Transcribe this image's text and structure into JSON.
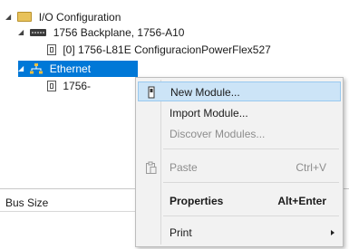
{
  "tree": {
    "root": {
      "label": "I/O Configuration",
      "icon": "folder-icon"
    },
    "backplane": {
      "label": "1756 Backplane, 1756-A10",
      "icon": "backplane-icon"
    },
    "controller": {
      "label": "[0] 1756-L81E ConfiguracionPowerFlex527",
      "icon": "module-icon"
    },
    "ethernet": {
      "label": "Ethernet",
      "icon": "network-icon"
    },
    "child": {
      "label": "1756-",
      "icon": "module-icon"
    }
  },
  "bottom_panel": {
    "bus_size_label": "Bus Size"
  },
  "context_menu": {
    "new_module": "New Module...",
    "import_module": "Import Module...",
    "discover_modules": "Discover Modules...",
    "paste": "Paste",
    "paste_shortcut": "Ctrl+V",
    "properties": "Properties",
    "properties_shortcut": "Alt+Enter",
    "print": "Print"
  },
  "colors": {
    "selection": "#0078d7",
    "hover": "#cce4f7",
    "menu_bg": "#f2f2f2",
    "disabled": "#8d8d8d"
  }
}
